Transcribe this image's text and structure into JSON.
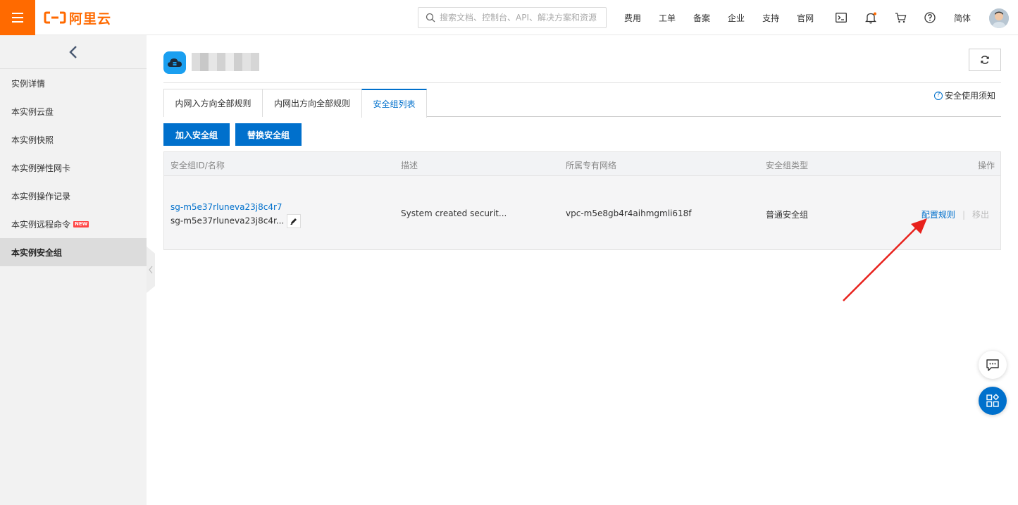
{
  "header": {
    "logo_text": "阿里云",
    "search_placeholder": "搜索文档、控制台、API、解决方案和资源",
    "nav": [
      "费用",
      "工单",
      "备案",
      "企业",
      "支持",
      "官网"
    ],
    "icons": [
      "terminal-icon",
      "bell-icon",
      "cart-icon",
      "help-icon"
    ],
    "lang": "简体",
    "accent": "#ff6a00"
  },
  "sidebar": {
    "items": [
      {
        "label": "实例详情"
      },
      {
        "label": "本实例云盘"
      },
      {
        "label": "本实例快照"
      },
      {
        "label": "本实例弹性网卡"
      },
      {
        "label": "本实例操作记录"
      },
      {
        "label": "本实例远程命令",
        "badge": "NEW"
      },
      {
        "label": "本实例安全组",
        "active": true
      }
    ]
  },
  "main": {
    "tabs": [
      {
        "label": "内网入方向全部规则"
      },
      {
        "label": "内网出方向全部规则"
      },
      {
        "label": "安全组列表",
        "active": true
      }
    ],
    "help_link": "安全使用须知",
    "buttons": {
      "join": "加入安全组",
      "replace": "替换安全组"
    },
    "table": {
      "headers": [
        "安全组ID/名称",
        "描述",
        "所属专有网络",
        "安全组类型",
        "操作"
      ],
      "rows": [
        {
          "id": "sg-m5e37rluneva23j8c4r7",
          "name": "sg-m5e37rluneva23j8c4r...",
          "desc": "System created securit...",
          "vpc": "vpc-m5e8gb4r4aihmgmli618f",
          "type": "普通安全组",
          "op_config": "配置规则",
          "op_remove": "移出"
        }
      ]
    }
  },
  "colors": {
    "primary": "#0070cc",
    "annotation": "#e8211c"
  }
}
